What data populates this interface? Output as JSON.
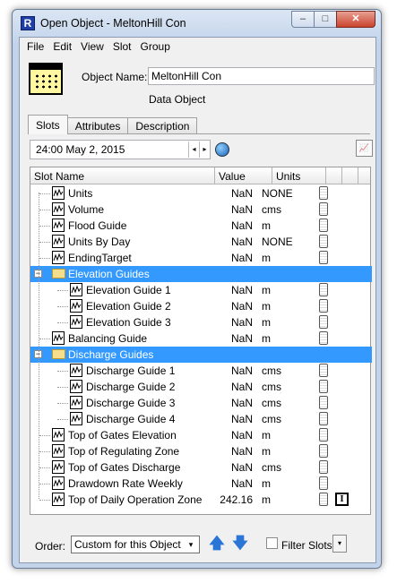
{
  "window": {
    "title": "Open Object - MeltonHill Con",
    "app_icon_letter": "R"
  },
  "window_buttons": {
    "minimize": "–",
    "maximize": "□",
    "close": "✕"
  },
  "menu": [
    "File",
    "Edit",
    "View",
    "Slot",
    "Group"
  ],
  "object": {
    "name_label": "Object Name:",
    "name_value": "MeltonHill Con",
    "type": "Data Object"
  },
  "tabs": [
    "Slots",
    "Attributes",
    "Description"
  ],
  "date": {
    "value": "24:00 May 2, 2015",
    "prev": "◂",
    "next": "▸"
  },
  "columns": {
    "slot_name": "Slot Name",
    "value": "Value",
    "units": "Units"
  },
  "rows": [
    {
      "name": "Units",
      "value": "NaN",
      "units": "NONE",
      "type": "slot",
      "level": 1
    },
    {
      "name": "Volume",
      "value": "NaN",
      "units": "cms",
      "type": "slot",
      "level": 1
    },
    {
      "name": "Flood Guide",
      "value": "NaN",
      "units": "m",
      "type": "slot",
      "level": 1
    },
    {
      "name": "Units By Day",
      "value": "NaN",
      "units": "NONE",
      "type": "slot",
      "level": 1
    },
    {
      "name": "EndingTarget",
      "value": "NaN",
      "units": "m",
      "type": "slot",
      "level": 1
    },
    {
      "name": "Elevation Guides",
      "value": "",
      "units": "",
      "type": "group",
      "level": 1
    },
    {
      "name": "Elevation Guide 1",
      "value": "NaN",
      "units": "m",
      "type": "slot",
      "level": 2
    },
    {
      "name": "Elevation Guide 2",
      "value": "NaN",
      "units": "m",
      "type": "slot",
      "level": 2
    },
    {
      "name": "Elevation Guide 3",
      "value": "NaN",
      "units": "m",
      "type": "slot",
      "level": 2
    },
    {
      "name": "Balancing Guide",
      "value": "NaN",
      "units": "m",
      "type": "slot",
      "level": 1
    },
    {
      "name": "Discharge Guides",
      "value": "",
      "units": "",
      "type": "group",
      "level": 1
    },
    {
      "name": "Discharge Guide 1",
      "value": "NaN",
      "units": "cms",
      "type": "slot",
      "level": 2
    },
    {
      "name": "Discharge Guide 2",
      "value": "NaN",
      "units": "cms",
      "type": "slot",
      "level": 2
    },
    {
      "name": "Discharge Guide 3",
      "value": "NaN",
      "units": "cms",
      "type": "slot",
      "level": 2
    },
    {
      "name": "Discharge Guide 4",
      "value": "NaN",
      "units": "cms",
      "type": "slot",
      "level": 2
    },
    {
      "name": "Top of Gates Elevation",
      "value": "NaN",
      "units": "m",
      "type": "slot",
      "level": 1
    },
    {
      "name": "Top of Regulating Zone",
      "value": "NaN",
      "units": "m",
      "type": "slot",
      "level": 1
    },
    {
      "name": "Top of Gates Discharge",
      "value": "NaN",
      "units": "cms",
      "type": "slot",
      "level": 1
    },
    {
      "name": "Drawdown Rate Weekly",
      "value": "NaN",
      "units": "m",
      "type": "slot",
      "level": 1
    },
    {
      "name": "Top of Daily Operation Zone",
      "value": "242.16",
      "units": "m",
      "type": "slot",
      "level": 1,
      "extra_icon": "I"
    }
  ],
  "order": {
    "label": "Order:",
    "value": "Custom for this Object",
    "up": "🡅",
    "down": "🡇"
  },
  "filter": {
    "label": "Filter Slots",
    "checked": false
  },
  "icons": {
    "dropdown": "▾",
    "expander": "−",
    "plot": "📈"
  },
  "colors": {
    "selection": "#3399ff",
    "folder": "#f5de8e",
    "object_icon": "#fff8a0"
  }
}
